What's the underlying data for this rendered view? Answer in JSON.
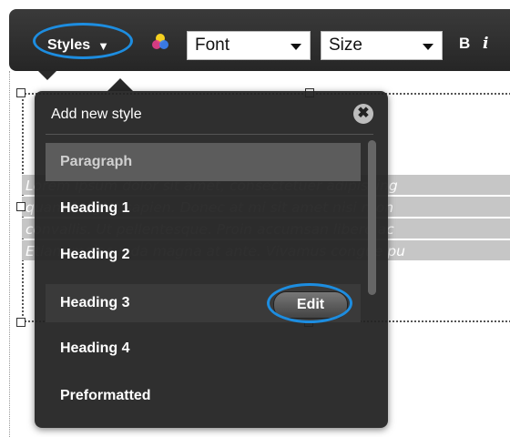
{
  "toolbar": {
    "styles_label": "Styles",
    "styles_arrow": "▼",
    "font_label": "Font",
    "size_label": "Size",
    "bold_label": "B",
    "italic_label": "i"
  },
  "dropdown": {
    "header": "Add new style",
    "close_glyph": "✖",
    "items": [
      {
        "label": "Paragraph",
        "state": "selected"
      },
      {
        "label": "Heading 1"
      },
      {
        "label": "Heading 2"
      },
      {
        "label": "Heading 3",
        "state": "hover",
        "action": "Edit"
      },
      {
        "label": "Heading 4"
      },
      {
        "label": "Preformatted"
      }
    ]
  },
  "editor": {
    "lines": [
      "Lorem ipsum dolor sit amet, consectetuer adipiscing",
      "quam feugiat sapien. Donec at mi sit amet nisi rhon",
      "convallis. Ut pellentesque. Proin accumsan libero ac",
      "Etiam malesuada magna at ante. Vivamus congue pu"
    ]
  },
  "colors": {
    "accent_ring": "#1d8de0",
    "toolbar_bg": "#2e2e2e",
    "menu_bg": "#222222"
  }
}
